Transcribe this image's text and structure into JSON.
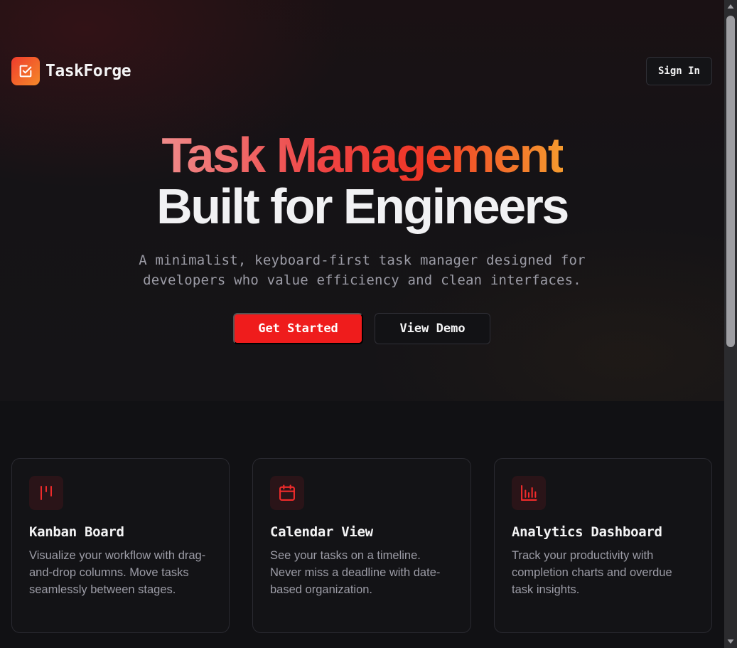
{
  "header": {
    "brand_name": "TaskForge",
    "logo_icon": "checkbox-icon",
    "signin_label": "Sign In"
  },
  "hero": {
    "headline_line1": "Task Management",
    "headline_line2": "Built for Engineers",
    "subtitle_line1": "A minimalist, keyboard-first task manager designed for",
    "subtitle_line2": "developers who value efficiency and clean interfaces.",
    "primary_cta": "Get Started",
    "secondary_cta": "View Demo"
  },
  "features": [
    {
      "icon": "kanban-icon",
      "title": "Kanban Board",
      "description": "Visualize your workflow with drag-and-drop columns. Move tasks seamlessly between stages."
    },
    {
      "icon": "calendar-icon",
      "title": "Calendar View",
      "description": "See your tasks on a timeline. Never miss a deadline with date-based organization."
    },
    {
      "icon": "bar-chart-icon",
      "title": "Analytics Dashboard",
      "description": "Track your productivity with completion charts and overdue task insights."
    }
  ],
  "colors": {
    "accent": "#ef1c1c",
    "accent_orange": "#f59a2e",
    "background": "#111114",
    "card_border": "#2a2a31",
    "muted_text": "#9c9ca6"
  },
  "scroll": {
    "position_fraction": 0.0
  }
}
